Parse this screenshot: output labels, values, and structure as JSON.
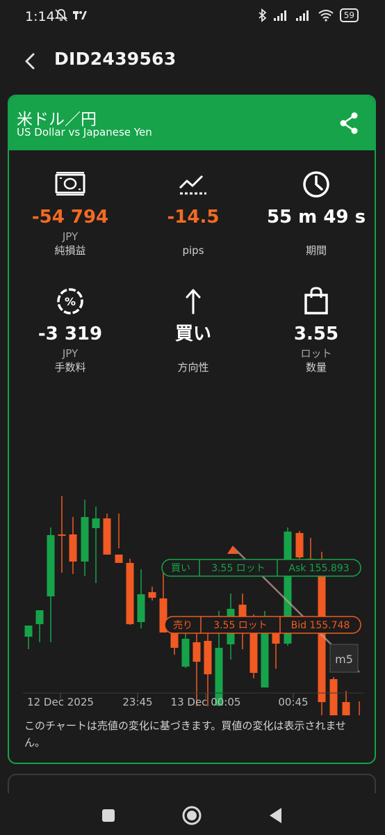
{
  "status": {
    "time": "1:14",
    "battery": "59"
  },
  "topbar": {
    "title": "DID2439563"
  },
  "card": {
    "pair_jp": "米ドル／円",
    "pair_en": "US Dollar vs Japanese Yen"
  },
  "metrics": {
    "net_pl": {
      "value": "-54 794",
      "unit": "JPY",
      "label": "純損益"
    },
    "pips": {
      "value": "-14.5",
      "label": "pips"
    },
    "duration": {
      "value": "55 m 49 s",
      "label": "期間"
    },
    "commission": {
      "value": "-3 319",
      "unit": "JPY",
      "label": "手数料"
    },
    "direction": {
      "value": "買い",
      "label": "方向性"
    },
    "quantity": {
      "value": "3.55",
      "unit": "ロット",
      "label": "数量"
    }
  },
  "chart_data": {
    "type": "candlestick",
    "timeframe": "m5",
    "x_labels": [
      "12 Dec 2025",
      "23:45",
      "13 Dec 00:05",
      "00:45"
    ],
    "colors": {
      "up": "#16a34a",
      "down": "#f15a22"
    },
    "buy_line": {
      "side": "買い",
      "lots": "3.55 ロット",
      "price_label": "Ask 155.893"
    },
    "sell_line": {
      "side": "売り",
      "lots": "3.55 ロット",
      "price_label": "Bid 155.748"
    }
  },
  "chart_note": "このチャートは売値の変化に基づきます。買値の変化は表示されません。",
  "colors": {
    "accent_green": "#16a34a",
    "loss_orange": "#f26b22",
    "background": "#1c1c1c"
  }
}
